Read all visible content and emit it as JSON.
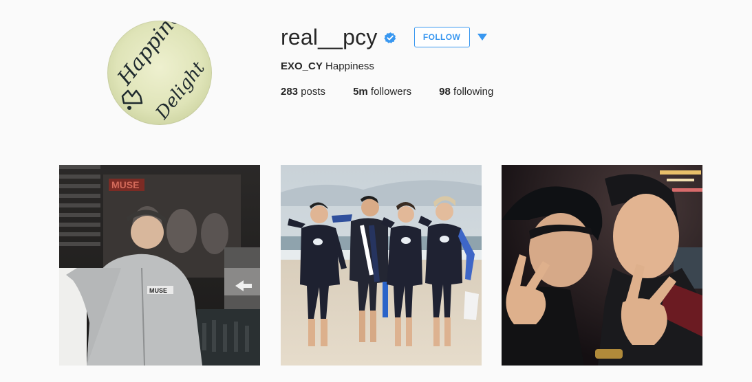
{
  "profile": {
    "username": "real__pcy",
    "verified": true,
    "follow_label": "FOLLOW",
    "full_name": "EXO_CY",
    "bio": "Happiness",
    "avatar_text": [
      "Happiness",
      "Delight"
    ],
    "stats": {
      "posts_count": "283",
      "posts_label": "posts",
      "followers_count": "5m",
      "followers_label": "followers",
      "following_count": "98",
      "following_label": "following"
    }
  },
  "posts": [
    {
      "id": "post-1",
      "sign_text": "MUSE",
      "shirt_text": "MUSE"
    },
    {
      "id": "post-2"
    },
    {
      "id": "post-3"
    }
  ],
  "colors": {
    "accent": "#3897f0",
    "text": "#262626",
    "background": "#fafafa",
    "verified_badge": "#3897f0"
  }
}
